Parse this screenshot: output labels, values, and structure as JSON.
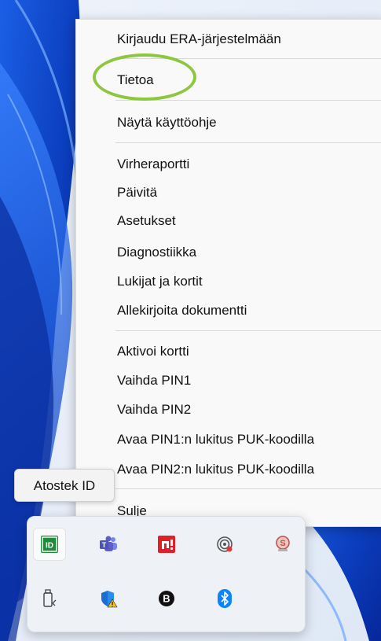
{
  "menu": {
    "items": [
      {
        "label": "Kirjaudu ERA-järjestelmään"
      },
      {
        "label": "Tietoa"
      },
      {
        "label": "Näytä käyttöohje"
      },
      {
        "label": "Virheraportti"
      },
      {
        "label": "Päivitä"
      },
      {
        "label": "Asetukset"
      },
      {
        "label": "Diagnostiikka"
      },
      {
        "label": "Lukijat ja kortit"
      },
      {
        "label": "Allekirjoita dokumentti"
      },
      {
        "label": "Aktivoi kortti"
      },
      {
        "label": "Vaihda PIN1"
      },
      {
        "label": "Vaihda PIN2"
      },
      {
        "label": "Avaa PIN1:n lukitus PUK-koodilla"
      },
      {
        "label": "Avaa PIN2:n lukitus PUK-koodilla"
      },
      {
        "label": "Sulje"
      }
    ],
    "highlighted_item": "Tietoa",
    "highlight_color": "#8dc63f"
  },
  "tooltip": {
    "text": "Atostek ID"
  },
  "tray": {
    "icons": [
      {
        "name": "atostek-id-icon",
        "glyph": "ID",
        "color": "#1f8a3c"
      },
      {
        "name": "teams-icon",
        "color": "#5b5fc7"
      },
      {
        "name": "amd-icon",
        "color": "#e01f26"
      },
      {
        "name": "remote-access-icon",
        "color": "#555555"
      },
      {
        "name": "s-badge-icon",
        "glyph": "S",
        "color": "#c0504d"
      },
      {
        "name": "usb-eject-icon",
        "color": "#444444"
      },
      {
        "name": "defender-warning-icon",
        "color": "#1a6fd1"
      },
      {
        "name": "b-app-icon",
        "glyph": "B",
        "color": "#111111"
      },
      {
        "name": "bluetooth-icon",
        "color": "#0a84ff"
      }
    ]
  }
}
